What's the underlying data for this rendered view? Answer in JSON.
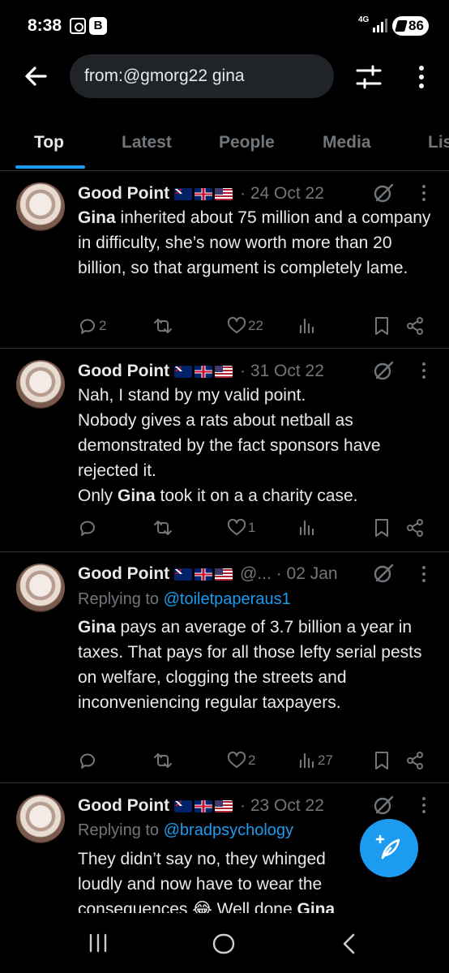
{
  "status_bar": {
    "time": "8:38",
    "b_icon": "B",
    "network": "4G",
    "battery": "86"
  },
  "search": {
    "query": "from:@gmorg22 gina"
  },
  "tabs": [
    {
      "label": "Top",
      "active": true
    },
    {
      "label": "Latest"
    },
    {
      "label": "People"
    },
    {
      "label": "Media"
    },
    {
      "label": "Lis"
    }
  ],
  "tweets": [
    {
      "name": "Good Point",
      "handle": "",
      "dot": "·",
      "date": "24 Oct 22",
      "reply_prefix": "",
      "reply_to": "",
      "body_html": "<b>Gina</b> inherited about 75 million and a company in difficulty, she’s now worth more than 20 billion, so that argument is completely lame.",
      "replies": "2",
      "retweets": "",
      "likes": "22",
      "views": ""
    },
    {
      "name": "Good Point",
      "handle": "",
      "dot": "·",
      "date": "31 Oct 22",
      "reply_prefix": "",
      "reply_to": "",
      "body_html": "Nah, I stand by my valid point.<br>Nobody gives a rats about netball as demonstrated by the fact sponsors have rejected it.<br>Only <b>Gina</b> took it on a a charity case.",
      "replies": "",
      "retweets": "",
      "likes": "1",
      "views": ""
    },
    {
      "name": "Good Point",
      "handle": "@...",
      "dot": "·",
      "date": "02 Jan",
      "reply_prefix": "Replying to",
      "reply_to": "@toiletpaperaus1",
      "body_html": "<b>Gina</b> pays an average of 3.7 billion a year in taxes. That pays for all those lefty serial pests on welfare, clogging the streets and inconveniencing regular taxpayers.",
      "replies": "",
      "retweets": "",
      "likes": "2",
      "views": "27"
    },
    {
      "name": "Good Point",
      "handle": "",
      "dot": "·",
      "date": "23 Oct 22",
      "reply_prefix": "Replying to",
      "reply_to": "@bradpsychology",
      "body_html": "They didn’t say no, they whinged loudly and now have to wear the consequences 😂 Well done <b>Gina</b>"
    }
  ],
  "colors": {
    "accent": "#1d9bf0",
    "background": "#000000",
    "muted": "#71767b"
  },
  "icons": [
    "back-arrow-icon",
    "filter-icon",
    "more-vertical-icon",
    "grok-icon",
    "reply-icon",
    "retweet-icon",
    "like-icon",
    "views-icon",
    "bookmark-icon",
    "share-icon",
    "compose-icon",
    "recents-icon",
    "home-icon",
    "back-icon"
  ]
}
